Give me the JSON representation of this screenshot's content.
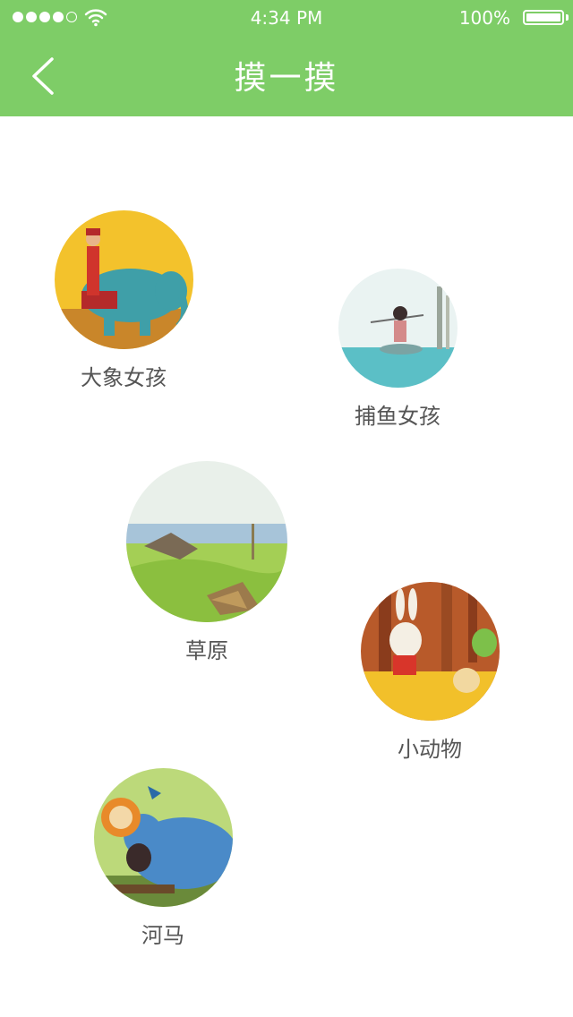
{
  "status_bar": {
    "time": "4:34 PM",
    "battery": "100%",
    "signal_icon": "signal-dots-icon",
    "wifi_icon": "wifi-icon",
    "battery_icon": "battery-icon"
  },
  "header": {
    "title": "摸一摸",
    "back_icon": "chevron-left-icon",
    "background": "#7ecd67"
  },
  "items": [
    {
      "label": "大象女孩",
      "image": "elephant-girl-illustration"
    },
    {
      "label": "捕鱼女孩",
      "image": "fishing-girl-illustration"
    },
    {
      "label": "草原",
      "image": "grassland-illustration"
    },
    {
      "label": "小动物",
      "image": "small-animals-illustration"
    },
    {
      "label": "河马",
      "image": "hippo-illustration"
    }
  ]
}
